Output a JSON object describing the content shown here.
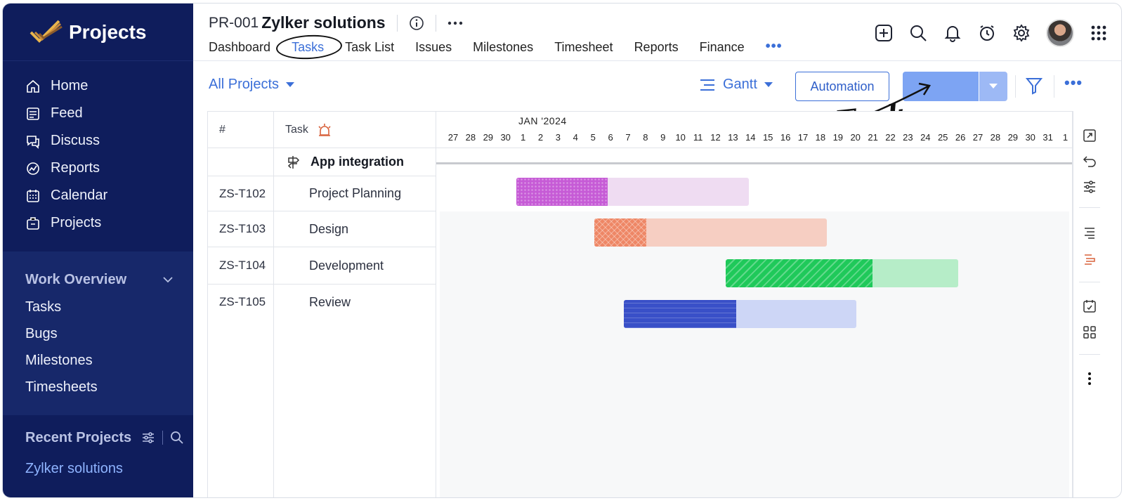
{
  "sidebar": {
    "brand": "Projects",
    "nav": [
      {
        "label": "Home",
        "icon": "home-icon"
      },
      {
        "label": "Feed",
        "icon": "feed-icon"
      },
      {
        "label": "Discuss",
        "icon": "discuss-icon"
      },
      {
        "label": "Reports",
        "icon": "reports-icon"
      },
      {
        "label": "Calendar",
        "icon": "calendar-icon"
      },
      {
        "label": "Projects",
        "icon": "projects-icon"
      }
    ],
    "work_overview": {
      "title": "Work Overview",
      "items": [
        "Tasks",
        "Bugs",
        "Milestones",
        "Timesheets"
      ]
    },
    "recent": {
      "title": "Recent Projects",
      "items": [
        "Zylker solutions"
      ]
    }
  },
  "header": {
    "project_id": "PR-001",
    "project_name": "Zylker solutions",
    "tabs": [
      "Dashboard",
      "Tasks",
      "Task List",
      "Issues",
      "Milestones",
      "Timesheet",
      "Reports",
      "Finance"
    ],
    "active_tab": "Tasks",
    "more": "•••"
  },
  "toolbar": {
    "all_projects": "All Projects",
    "view": "Gantt",
    "automation": "Automation",
    "more": "•••"
  },
  "annotation": "Add Task",
  "grid": {
    "col_id": "#",
    "col_task": "Task",
    "group": "App integration",
    "rows": [
      {
        "id": "ZS-T102",
        "task": "Project Planning"
      },
      {
        "id": "ZS-T103",
        "task": "Design"
      },
      {
        "id": "ZS-T104",
        "task": "Development"
      },
      {
        "id": "ZS-T105",
        "task": "Review"
      }
    ]
  },
  "timeline": {
    "month": "JAN '2024",
    "days": [
      "27",
      "28",
      "29",
      "30",
      "1",
      "2",
      "3",
      "4",
      "5",
      "6",
      "7",
      "8",
      "9",
      "10",
      "11",
      "12",
      "13",
      "14",
      "15",
      "16",
      "17",
      "18",
      "19",
      "20",
      "21",
      "22",
      "23",
      "24",
      "25",
      "26",
      "27",
      "28",
      "29",
      "30",
      "31",
      "1"
    ]
  },
  "colors": {
    "sidebar_bg": "#0f1d5c",
    "accent": "#3b6fd8",
    "planning": "#c65bd6",
    "design": "#ee8766",
    "development": "#1fc95a",
    "review": "#3950c8"
  }
}
